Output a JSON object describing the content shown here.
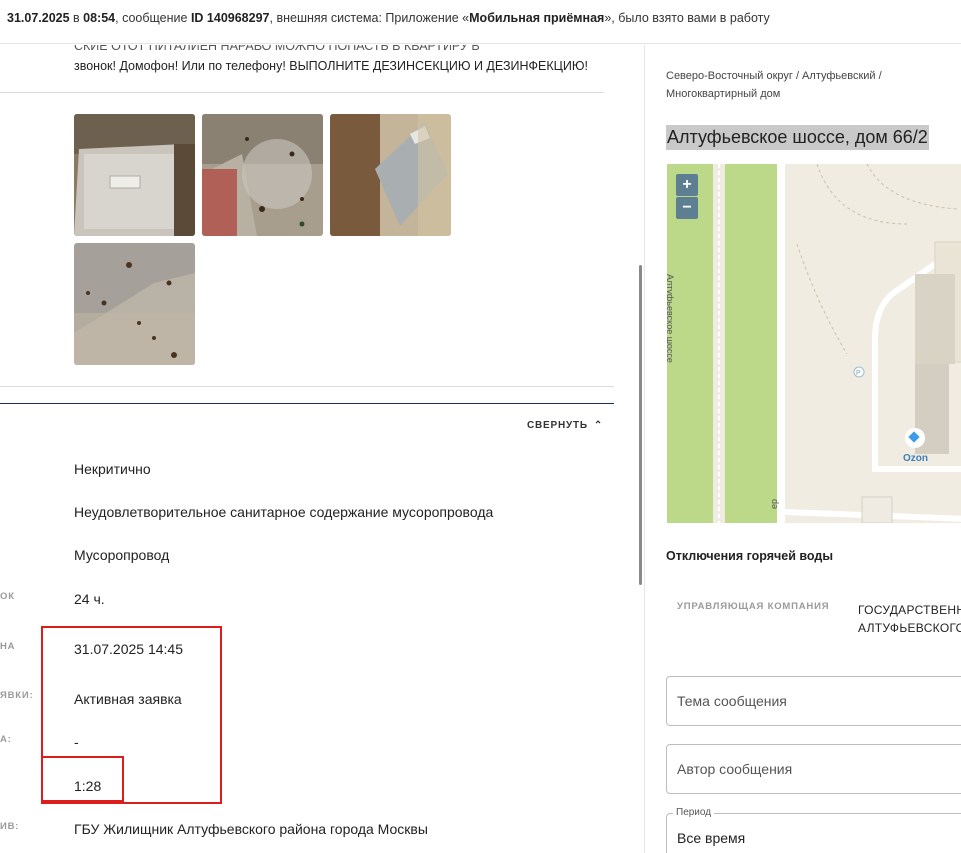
{
  "topbar": {
    "date": "31.07.2025",
    "in_word": " в ",
    "time": "08:54",
    "msg_prefix": ", сообщение ",
    "msg_id": "ID 140968297",
    "sys_prefix": ", внешняя система: Приложение «",
    "system_name": "Мобильная приёмная",
    "suffix": "», было взято вами в работу"
  },
  "description": {
    "partial_line": "СКИЕ ОТОТ ПИТАЛИЕН НАРАВО МОЖНО ПОПАСТЬ В КВАРТИРУ В",
    "text": "звонок! Домофон! Или по телефону! ВЫПОЛНИТЕ ДЕЗИНСЕКЦИЮ И ДЕЗИНФЕКЦИЮ!"
  },
  "collapse_label": "СВЕРНУТЬ",
  "details": {
    "priority": "Некритично",
    "problem": "Неудовлетворительное санитарное содержание мусоропровода",
    "category": "Мусоропровод",
    "deadline_label": "ОК",
    "deadline": "24 ч.",
    "due_label": "НА",
    "due": "31.07.2025 14:45",
    "status_label": "ЯВКИ:",
    "status": "Активная заявка",
    "field_label_a": "А:",
    "dash": "-",
    "time_left": "1:28",
    "exec_label": "ИВ:",
    "executor": "ГБУ Жилищник Алтуфьевского района города Москвы"
  },
  "right": {
    "breadcrumb": "Северо-Восточный округ / Алтуфьевский / Многоквартирный дом",
    "address": "Алтуфьевское шоссе, дом 66/2",
    "map": {
      "zoom_in": "+",
      "zoom_out": "−",
      "road_label": "Алтуфьевское шоссе",
      "poi_ozon": "Ozon",
      "parking": "P",
      "road_label_2": "ер"
    },
    "hot_water_title": "Отключения горячей воды",
    "uk_label": "УПРАВЛЯЮЩАЯ КОМПАНИЯ",
    "uk_value_line1": "ГОСУДАРСТВЕННОЕ",
    "uk_value_line2": "АЛТУФЬЕВСКОГО",
    "subject_placeholder": "Тема сообщения",
    "author_placeholder": "Автор сообщения",
    "period_label": "Период",
    "period_value": "Все время"
  },
  "colors": {
    "accent_line": "#1c2a66",
    "highlight_box": "#dd1c1c",
    "map_green": "#bcd98a",
    "zoom_button": "#5e7f91"
  }
}
